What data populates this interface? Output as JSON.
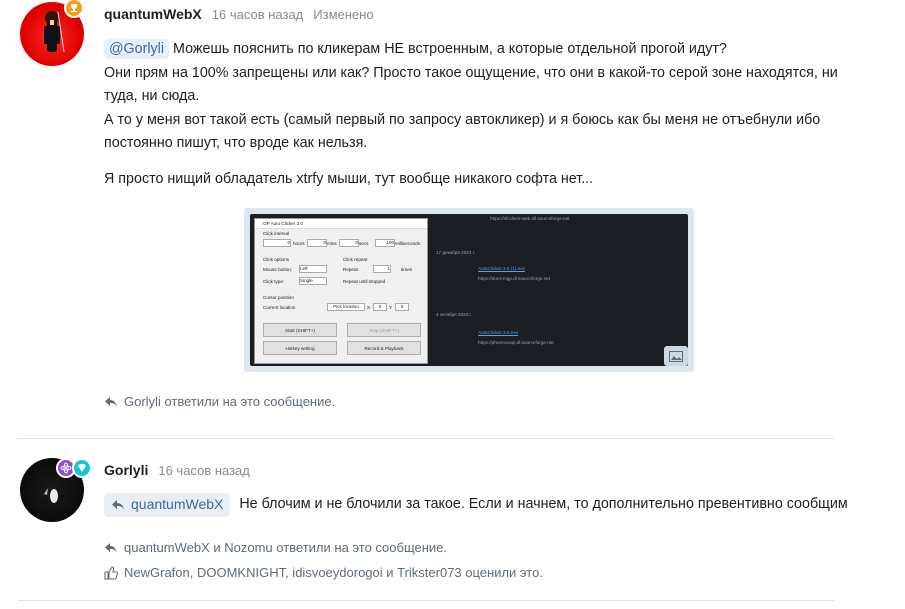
{
  "post1": {
    "author": "quantumWebX",
    "time": "16 часов назад",
    "edited": "Изменено",
    "mention": "@Gorlyli",
    "line1": "Можешь пояснить по кликерам НЕ встроенным, а которые отдельной прогой идут?",
    "line2": "Они прям на 100% запрещены или как? Просто такое ощущение, что они в какой-то серой зоне находятся, ни туда, ни сюда.",
    "line3": "А то у меня вот такой есть (самый первый по запросу автокликер) и я боюсь как бы меня не отъебнули ибо постоянно пишут, что вроде как нельзя.",
    "line4": "Я просто нищий обладатель xtrfy мыши, тут вообще никакого софта нет...",
    "replied": "Gorlyli ответили на это сообщение."
  },
  "screenshot": {
    "dialog_title": "OP Auto Clicker 3.0",
    "click_interval": "Click interval",
    "hours": "hours",
    "mins": "mins",
    "secs": "secs",
    "ms": "milliseconds",
    "hours_val": "0",
    "mins_val": "0",
    "secs_val": "0",
    "ms_val": "100",
    "click_options": "Click options",
    "mouse_button": "Mouse button:",
    "mouse_button_val": "Left",
    "click_type": "Click type:",
    "click_type_val": "Single",
    "click_repeat": "Click repeat",
    "repeat": "Repeat",
    "repeat_val": "1",
    "times": "times",
    "repeat_until": "Repeat until stopped",
    "cursor_position": "Cursor position",
    "current_location": "Current location",
    "pick_location": "Pick location",
    "x_label": "X",
    "x_val": "0",
    "y_label": "Y",
    "y_val": "0",
    "start": "Start (SHIFT+)",
    "stop": "Stop (SHIFT+)",
    "hotkey": "Hotkey setting",
    "record": "Record & Playback",
    "link_top": "https://sfcclient-web.sfl.sourceforge.net",
    "date1": "17 декабря 2023 г.",
    "file1": "AutoClicker-3.0 (1).exe",
    "url1": "https://docs-mgp.dl.sourceforge.net",
    "date2": "4 октября 2023 г.",
    "file2": "AutoClicker-3.0.exe",
    "url2": "https://phoenixnap.dl.sourceforge.net"
  },
  "post2": {
    "author": "Gorlyli",
    "time": "16 часов назад",
    "quote_user": "quantumWebX",
    "text": "Не блочим и не блочили за такое. Если и начнем, то дополнительно превентивно сообщим",
    "replied": "quantumWebX и Nozomu ответили на это сообщение.",
    "liked": "NewGrafon, DOOMKNIGHT, idisvoeydorogoi и Trikster073 оценили это."
  },
  "colors": {
    "accent": "#3a6a9e",
    "badge_orange": "#f0a020",
    "badge_purple": "#8a4fd0",
    "badge_teal": "#16c4d8"
  }
}
